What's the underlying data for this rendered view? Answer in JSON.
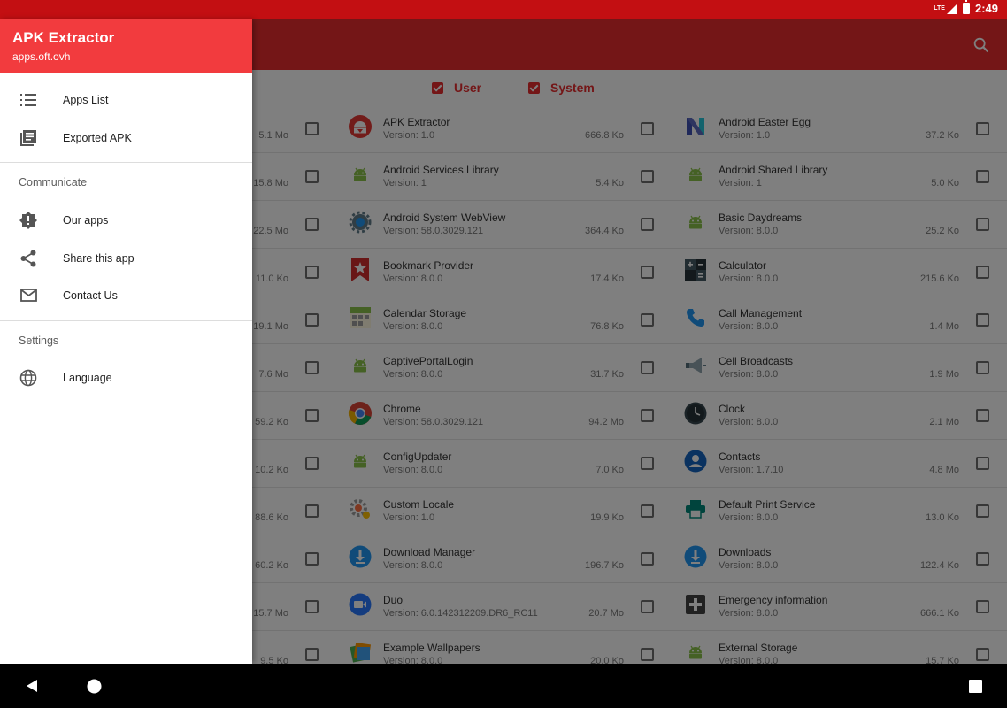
{
  "status_bar": {
    "network": "LTE",
    "time": "2:49"
  },
  "filters": {
    "user_label": "User",
    "system_label": "System"
  },
  "drawer": {
    "title": "APK Extractor",
    "subtitle": "apps.oft.ovh",
    "items": [
      {
        "label": "Apps List",
        "icon": "list-icon"
      },
      {
        "label": "Exported APK",
        "icon": "library-icon"
      }
    ],
    "communicate_title": "Communicate",
    "communicate_items": [
      {
        "label": "Our apps",
        "icon": "badge-alert-icon"
      },
      {
        "label": "Share this app",
        "icon": "share-icon"
      },
      {
        "label": "Contact Us",
        "icon": "mail-icon"
      }
    ],
    "settings_title": "Settings",
    "settings_items": [
      {
        "label": "Language",
        "icon": "globe-icon"
      }
    ]
  },
  "apps": {
    "col1": [
      {
        "size": "5.1 Mo"
      },
      {
        "size": "15.8 Mo"
      },
      {
        "size": "22.5 Mo"
      },
      {
        "size": "11.0 Ko"
      },
      {
        "size": "19.1 Mo"
      },
      {
        "size": "7.6 Mo"
      },
      {
        "size": "59.2 Ko"
      },
      {
        "size": "10.2 Ko"
      },
      {
        "size": "88.6 Ko"
      },
      {
        "size": "60.2 Ko"
      },
      {
        "size": "15.7 Mo"
      },
      {
        "size": "9.5 Ko"
      }
    ],
    "col2": [
      {
        "name": "APK Extractor",
        "version": "Version: 1.0",
        "size": "666.8 Ko",
        "icon": "apk-extractor-icon"
      },
      {
        "name": "Android Services Library",
        "version": "Version: 1",
        "size": "5.4 Ko",
        "icon": "android-icon"
      },
      {
        "name": "Android System WebView",
        "version": "Version: 58.0.3029.121",
        "size": "364.4 Ko",
        "icon": "webview-gear-icon"
      },
      {
        "name": "Bookmark Provider",
        "version": "Version: 8.0.0",
        "size": "17.4 Ko",
        "icon": "bookmark-star-icon"
      },
      {
        "name": "Calendar Storage",
        "version": "Version: 8.0.0",
        "size": "76.8 Ko",
        "icon": "calendar-icon"
      },
      {
        "name": "CaptivePortalLogin",
        "version": "Version: 8.0.0",
        "size": "31.7 Ko",
        "icon": "android-icon"
      },
      {
        "name": "Chrome",
        "version": "Version: 58.0.3029.121",
        "size": "94.2 Mo",
        "icon": "chrome-icon"
      },
      {
        "name": "ConfigUpdater",
        "version": "Version: 8.0.0",
        "size": "7.0 Ko",
        "icon": "android-icon"
      },
      {
        "name": "Custom Locale",
        "version": "Version: 1.0",
        "size": "19.9 Ko",
        "icon": "locale-gear-icon"
      },
      {
        "name": "Download Manager",
        "version": "Version: 8.0.0",
        "size": "196.7 Ko",
        "icon": "download-icon"
      },
      {
        "name": "Duo",
        "version": "Version: 6.0.142312209.DR6_RC11",
        "size": "20.7 Mo",
        "icon": "video-camera-icon"
      },
      {
        "name": "Example Wallpapers",
        "version": "Version: 8.0.0",
        "size": "20.0 Ko",
        "icon": "wallpapers-icon"
      }
    ],
    "col3": [
      {
        "name": "Android Easter Egg",
        "version": "Version: 1.0",
        "size": "37.2 Ko",
        "icon": "n-logo-icon"
      },
      {
        "name": "Android Shared Library",
        "version": "Version: 1",
        "size": "5.0 Ko",
        "icon": "android-icon"
      },
      {
        "name": "Basic Daydreams",
        "version": "Version: 8.0.0",
        "size": "25.2 Ko",
        "icon": "android-icon"
      },
      {
        "name": "Calculator",
        "version": "Version: 8.0.0",
        "size": "215.6 Ko",
        "icon": "calculator-icon"
      },
      {
        "name": "Call Management",
        "version": "Version: 8.0.0",
        "size": "1.4 Mo",
        "icon": "phone-icon"
      },
      {
        "name": "Cell Broadcasts",
        "version": "Version: 8.0.0",
        "size": "1.9 Mo",
        "icon": "megaphone-icon"
      },
      {
        "name": "Clock",
        "version": "Version: 8.0.0",
        "size": "2.1 Mo",
        "icon": "clock-icon"
      },
      {
        "name": "Contacts",
        "version": "Version: 1.7.10",
        "size": "4.8 Mo",
        "icon": "contacts-icon"
      },
      {
        "name": "Default Print Service",
        "version": "Version: 8.0.0",
        "size": "13.0 Ko",
        "icon": "printer-icon"
      },
      {
        "name": "Downloads",
        "version": "Version: 8.0.0",
        "size": "122.4 Ko",
        "icon": "download-icon"
      },
      {
        "name": "Emergency information",
        "version": "Version: 8.0.0",
        "size": "666.1 Ko",
        "icon": "medical-cross-icon"
      },
      {
        "name": "External Storage",
        "version": "Version: 8.0.0",
        "size": "15.7 Ko",
        "icon": "android-icon"
      }
    ]
  },
  "colors": {
    "primary": "#e82c2f",
    "primary_dark": "#c30f12",
    "drawer_header": "#f23b3e"
  }
}
